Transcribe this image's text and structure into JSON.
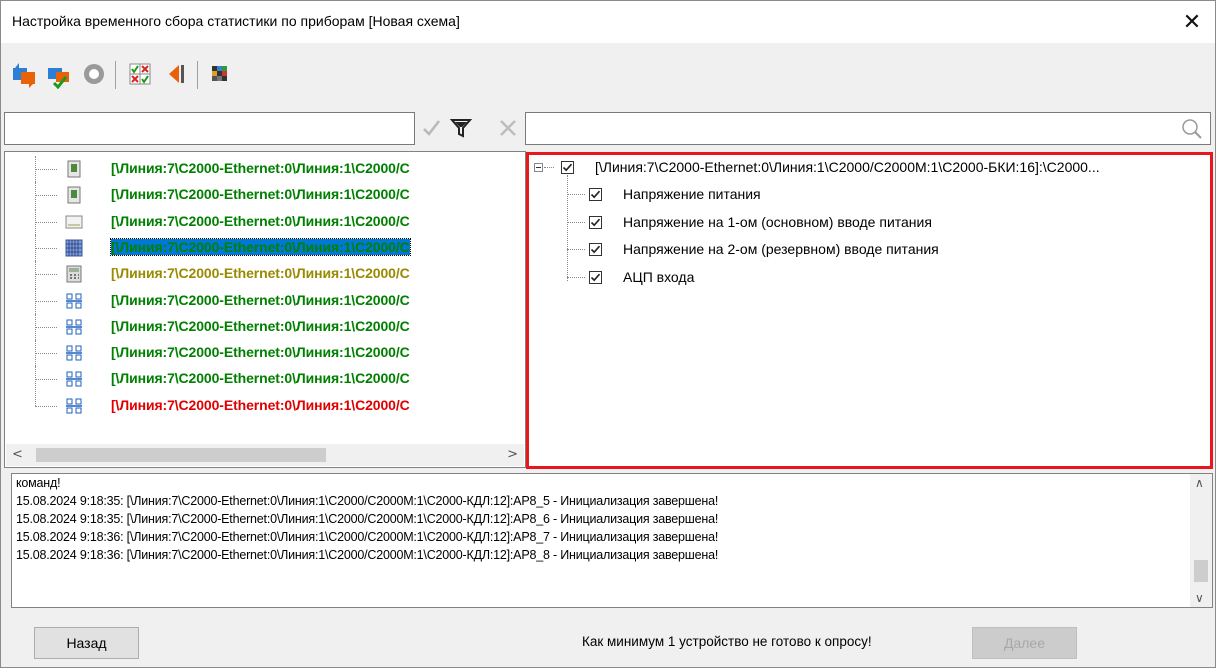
{
  "window": {
    "title": "Настройка временного сбора статистики по приборам [Новая схема]",
    "close_glyph": "✕"
  },
  "toolbar": {
    "buttons": [
      {
        "icon": "refresh-arrows-icon"
      },
      {
        "icon": "refresh-selected-icon"
      },
      {
        "icon": "stop-icon"
      },
      {
        "icon": "checkbox-matrix-icon"
      },
      {
        "icon": "collapse-left-icon"
      },
      {
        "icon": "color-grid-icon"
      }
    ]
  },
  "filter": {
    "value": "",
    "search_value": ""
  },
  "devices": [
    {
      "label": "[\\Линия:7\\С2000-Ethernet:0\\Линия:1\\С2000/С",
      "color": "#008000",
      "icon": "device-module-icon"
    },
    {
      "label": "[\\Линия:7\\С2000-Ethernet:0\\Линия:1\\С2000/С",
      "color": "#008000",
      "icon": "device-module-icon"
    },
    {
      "label": "[\\Линия:7\\С2000-Ethernet:0\\Линия:1\\С2000/С",
      "color": "#008000",
      "icon": "device-panel-icon"
    },
    {
      "label": "[\\Линия:7\\С2000-Ethernet:0\\Линия:1\\С2000/С",
      "color": "#008000",
      "icon": "device-keypad-icon",
      "selected": true
    },
    {
      "label": "[\\Линия:7\\С2000-Ethernet:0\\Линия:1\\С2000/С",
      "color": "#9a8a00",
      "icon": "device-controller-icon"
    },
    {
      "label": "[\\Линия:7\\С2000-Ethernet:0\\Линия:1\\С2000/С",
      "color": "#008000",
      "icon": "device-network-icon"
    },
    {
      "label": "[\\Линия:7\\С2000-Ethernet:0\\Линия:1\\С2000/С",
      "color": "#008000",
      "icon": "device-network-icon"
    },
    {
      "label": "[\\Линия:7\\С2000-Ethernet:0\\Линия:1\\С2000/С",
      "color": "#008000",
      "icon": "device-network-icon"
    },
    {
      "label": "[\\Линия:7\\С2000-Ethernet:0\\Линия:1\\С2000/С",
      "color": "#008000",
      "icon": "device-network-icon"
    },
    {
      "label": "[\\Линия:7\\С2000-Ethernet:0\\Линия:1\\С2000/С",
      "color": "#e00000",
      "icon": "device-network-icon"
    }
  ],
  "params": {
    "root_label": "[\\Линия:7\\С2000-Ethernet:0\\Линия:1\\С2000/С2000М:1\\С2000-БКИ:16]:\\С2000...",
    "root_checked": true,
    "items": [
      {
        "label": "Напряжение питания",
        "checked": true
      },
      {
        "label": "Напряжение на 1-ом (основном) вводе питания",
        "checked": true
      },
      {
        "label": "Напряжение на 2-ом (резервном) вводе питания",
        "checked": true
      },
      {
        "label": "АЦП входа",
        "checked": true
      }
    ]
  },
  "log": {
    "lines": [
      "команд!",
      "15.08.2024 9:18:35: [\\Линия:7\\С2000-Ethernet:0\\Линия:1\\С2000/С2000М:1\\С2000-КДЛ:12]:АР8_5 - Инициализация завершена!",
      "15.08.2024 9:18:35: [\\Линия:7\\С2000-Ethernet:0\\Линия:1\\С2000/С2000М:1\\С2000-КДЛ:12]:АР8_6 - Инициализация завершена!",
      "15.08.2024 9:18:36: [\\Линия:7\\С2000-Ethernet:0\\Линия:1\\С2000/С2000М:1\\С2000-КДЛ:12]:АР8_7 - Инициализация завершена!",
      "15.08.2024 9:18:36: [\\Линия:7\\С2000-Ethernet:0\\Линия:1\\С2000/С2000М:1\\С2000-КДЛ:12]:АР8_8 - Инициализация завершена!"
    ]
  },
  "footer": {
    "back_label": "Назад",
    "status": "Как минимум 1 устройство не готово к опросу!",
    "next_label": "Далее",
    "next_enabled": false
  },
  "colors": {
    "selection": "#0078d7",
    "highlight_border": "#e8161d",
    "ready": "#008000",
    "warning": "#9a8a00",
    "error": "#e00000"
  }
}
